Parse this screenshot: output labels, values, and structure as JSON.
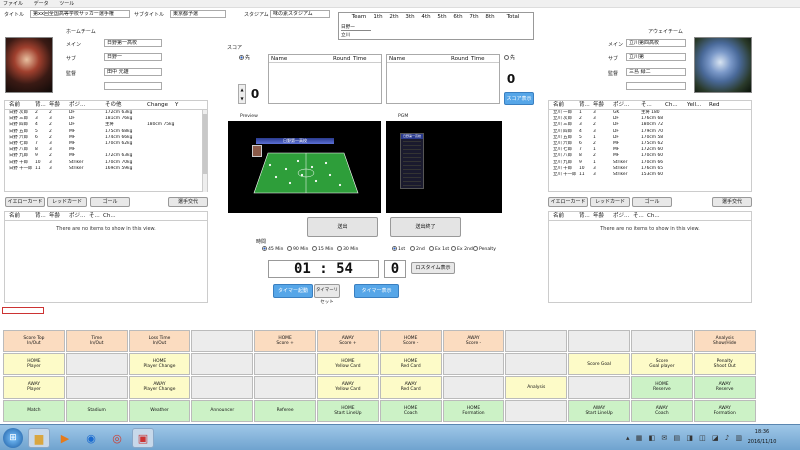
{
  "menu": [
    "ファイル",
    "データ",
    "ツール"
  ],
  "header": {
    "title_label": "タイトル",
    "title_value": "第xx回全国高等学校サッカー選手権",
    "subtitle_label": "サブタイトル",
    "subtitle_value": "東京都予選",
    "stadium_label": "スタジアム",
    "stadium_value": "味の素スタジアム"
  },
  "scoreboard": {
    "headers": [
      "Team",
      "1th",
      "2th",
      "3th",
      "4th",
      "5th",
      "6th",
      "7th",
      "8th",
      "Total"
    ],
    "home_team": "日野一",
    "away_team": "立川"
  },
  "home": {
    "section_label": "ホームチーム",
    "main_label": "メイン",
    "main_value": "日野第一高校",
    "sub_label": "サブ",
    "sub_value": "日野一",
    "coach_label": "監督",
    "coach_value": "田中 元雄",
    "columns": [
      "名前",
      "背...",
      "年齢",
      "ポジ...",
      "その他",
      "Change",
      "Y"
    ],
    "players": [
      [
        "日野 次郎",
        "2",
        "2",
        "DF",
        "172cm 63kg",
        "",
        ""
      ],
      [
        "日野 三郎",
        "3",
        "3",
        "DF",
        "181cm 76kg",
        "",
        ""
      ],
      [
        "日野 四郎",
        "4",
        "2",
        "DF",
        "主将",
        "180cm 75kg",
        ""
      ],
      [
        "日野 五郎",
        "5",
        "2",
        "MF",
        "175cm 68kg",
        "",
        ""
      ],
      [
        "日野 六郎",
        "6",
        "2",
        "MF",
        "174cm 66kg",
        "",
        ""
      ],
      [
        "日野 七郎",
        "7",
        "3",
        "MF",
        "170cm 62kg",
        "",
        ""
      ],
      [
        "日野 八郎",
        "8",
        "3",
        "MF",
        "",
        "",
        ""
      ],
      [
        "日野 九郎",
        "9",
        "2",
        "MF",
        "172cm 63kg",
        "",
        ""
      ],
      [
        "日野 十郎",
        "10",
        "3",
        "Striker",
        "170cm 70kg",
        "",
        ""
      ],
      [
        "日野 十一郎",
        "11",
        "3",
        "Striker",
        "169cm 59kg",
        "",
        ""
      ]
    ],
    "selected_index": 10,
    "buttons": [
      "イエローカード",
      "レッドカード",
      "ゴール",
      "選手交代"
    ],
    "sub_columns": [
      "名前",
      "背...",
      "年齢",
      "ポジ...",
      "そ...",
      "Ch..."
    ],
    "empty_text": "There are no items to show in this view."
  },
  "away": {
    "section_label": "アウェイチーム",
    "main_label": "メイン",
    "main_value": "立川第四高校",
    "sub_label": "サブ",
    "sub_value": "立川第",
    "coach_label": "監督",
    "coach_value": "三島 緑二",
    "columns": [
      "名前",
      "背...",
      "年齢",
      "ポジ...",
      "そ...",
      "Ch...",
      "Yell...",
      "Red"
    ],
    "players": [
      [
        "立川 一郎",
        "1",
        "3",
        "GK",
        "主将 180",
        ""
      ],
      [
        "立川 次郎",
        "2",
        "3",
        "DF",
        "176cm 68",
        ""
      ],
      [
        "立川 三郎",
        "3",
        "2",
        "DF",
        "180cm 72",
        ""
      ],
      [
        "立川 四郎",
        "4",
        "3",
        "DF",
        "179cm 70",
        ""
      ],
      [
        "立川 五郎",
        "5",
        "1",
        "DF",
        "170cm 58",
        ""
      ],
      [
        "立川 六郎",
        "6",
        "2",
        "MF",
        "175cm 62",
        ""
      ],
      [
        "立川 七郎",
        "7",
        "1",
        "MF",
        "172cm 60",
        ""
      ],
      [
        "立川 八郎",
        "8",
        "2",
        "MF",
        "170cm 60",
        ""
      ],
      [
        "立川 九郎",
        "9",
        "1",
        "Striker",
        "170cm 66",
        ""
      ],
      [
        "立川 十郎",
        "10",
        "3",
        "Striker",
        "176cm 65",
        ""
      ],
      [
        "立川 十一郎",
        "11",
        "3",
        "Striker",
        "153cm 60",
        ""
      ]
    ],
    "buttons": [
      "イエローカード",
      "レッドカード",
      "ゴール",
      "選手交代"
    ],
    "sub_columns": [
      "名前",
      "背...",
      "年齢",
      "ポジ...",
      "そ...",
      "Ch..."
    ],
    "empty_text": "There are no items to show in this view."
  },
  "score": {
    "label": "スコア",
    "home_radio": "先",
    "away_radio": "先",
    "home_score": "0",
    "away_score": "0",
    "columns": [
      "Name",
      "Round",
      "Time"
    ],
    "show_button": "スコア表示"
  },
  "preview": {
    "label": "Preview",
    "pgm_label": "PGM",
    "home_team": "日野第一高校",
    "away_team": "立川第四高校"
  },
  "controls": {
    "start_button": "送出",
    "end_button": "送出終了",
    "time_label": "時間",
    "time_options": [
      "45 Min",
      "90 Min",
      "15 Min",
      "30 Min"
    ],
    "half_options": [
      "1st",
      "2nd",
      "Ex 1st",
      "Ex 2nd",
      "Penalty"
    ],
    "clock": "01 : 54",
    "added_time": "0",
    "added_time_button": "ロスタイム表示",
    "timer_start_button": "タイマー起動",
    "timer_reset_button": "タイマーリセット",
    "timer_show_button": "タイマー表示"
  },
  "actions": [
    {
      "label": "Score Top\nIn/Out",
      "color": "orange"
    },
    {
      "label": "Time\nIn/Out",
      "color": "orange"
    },
    {
      "label": "Loss Time\nIn/Out",
      "color": "orange"
    },
    {
      "label": "",
      "color": "gray"
    },
    {
      "label": "HOME\nScore +",
      "color": "orange"
    },
    {
      "label": "AWAY\nScore +",
      "color": "orange"
    },
    {
      "label": "HOME\nScore -",
      "color": "orange"
    },
    {
      "label": "AWAY\nScore -",
      "color": "orange"
    },
    {
      "label": "",
      "color": "gray"
    },
    {
      "label": "",
      "color": "gray"
    },
    {
      "label": "",
      "color": "gray"
    },
    {
      "label": "Analysis\nShow/Hide",
      "color": "orange"
    },
    {
      "label": "HOME\nPlayer",
      "color": "yellow"
    },
    {
      "label": "",
      "color": "gray"
    },
    {
      "label": "HOME\nPlayer Change",
      "color": "yellow"
    },
    {
      "label": "",
      "color": "gray"
    },
    {
      "label": "",
      "color": "gray"
    },
    {
      "label": "HOME\nYellow Card",
      "color": "yellow"
    },
    {
      "label": "HOME\nRed Card",
      "color": "yellow"
    },
    {
      "label": "",
      "color": "gray"
    },
    {
      "label": "",
      "color": "gray"
    },
    {
      "label": "Score Goal",
      "color": "yellow"
    },
    {
      "label": "Score\nGoal player",
      "color": "yellow"
    },
    {
      "label": "Penalty\nShoot Out",
      "color": "yellow"
    },
    {
      "label": "AWAY\nPlayer",
      "color": "yellow"
    },
    {
      "label": "",
      "color": "gray"
    },
    {
      "label": "AWAY\nPlayer Change",
      "color": "yellow"
    },
    {
      "label": "",
      "color": "gray"
    },
    {
      "label": "",
      "color": "gray"
    },
    {
      "label": "AWAY\nYellow Card",
      "color": "yellow"
    },
    {
      "label": "AWAY\nRed Card",
      "color": "yellow"
    },
    {
      "label": "",
      "color": "gray"
    },
    {
      "label": "Analysis",
      "color": "yellow"
    },
    {
      "label": "",
      "color": "gray"
    },
    {
      "label": "HOME\nReserve",
      "color": "green"
    },
    {
      "label": "AWAY\nReserve",
      "color": "green"
    },
    {
      "label": "Match",
      "color": "green"
    },
    {
      "label": "Stadium",
      "color": "green"
    },
    {
      "label": "Weather",
      "color": "green"
    },
    {
      "label": "Announcer",
      "color": "green"
    },
    {
      "label": "Referee",
      "color": "green"
    },
    {
      "label": "HOME\nStart LineUp",
      "color": "green"
    },
    {
      "label": "HOME\nCoach",
      "color": "green"
    },
    {
      "label": "HOME\nFormation",
      "color": "green"
    },
    {
      "label": "",
      "color": "gray"
    },
    {
      "label": "AWAY\nStart LineUp",
      "color": "green"
    },
    {
      "label": "AWAY\nCoach",
      "color": "green"
    },
    {
      "label": "AWAY\nFormation",
      "color": "green"
    }
  ],
  "taskbar": {
    "time": "18:36",
    "date": "2016/11/10"
  },
  "colors": {
    "orange": "#fbdcc0",
    "yellow": "#fdfbc8",
    "green": "#ccf2c6",
    "gray": "#ececec",
    "accent": "#56a6e8",
    "pitch": "#2e9e3a"
  }
}
